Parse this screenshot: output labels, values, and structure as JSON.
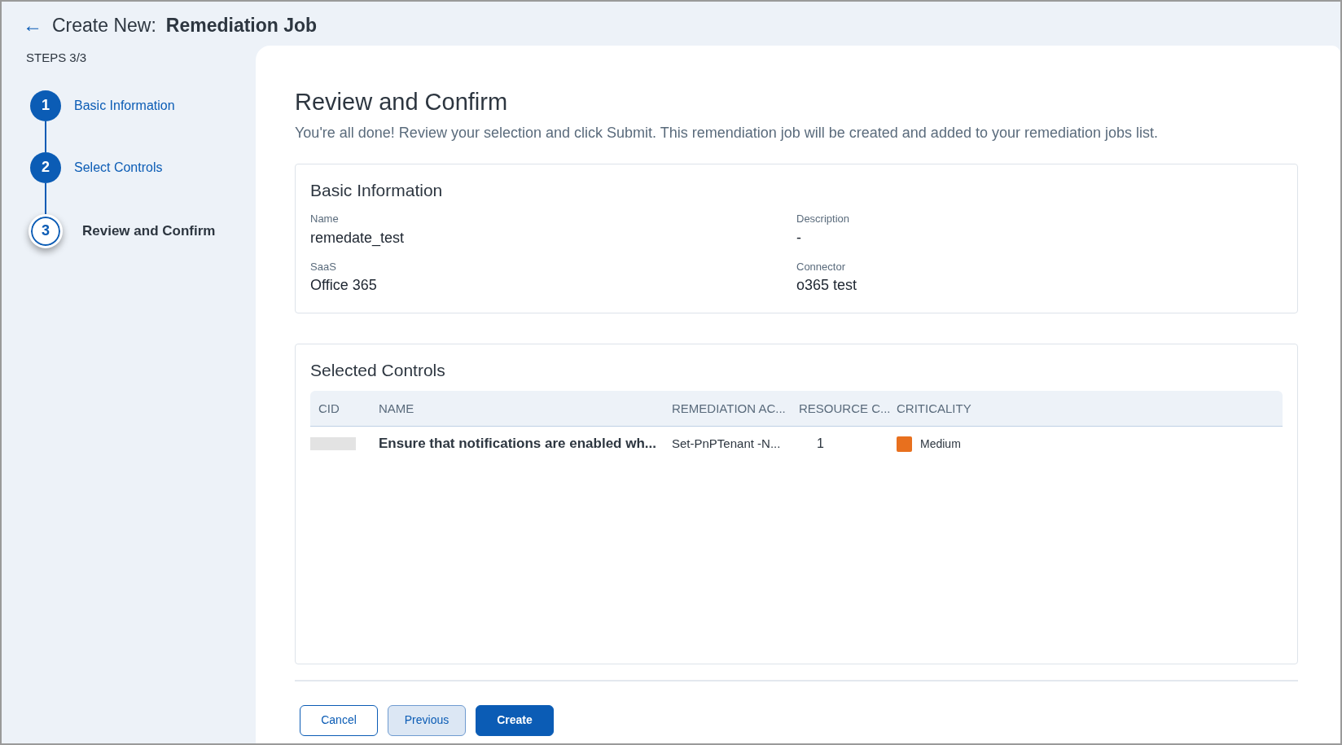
{
  "header": {
    "back_icon": "←",
    "title_prefix": "Create New:",
    "title": "Remediation Job"
  },
  "steps_label": "STEPS 3/3",
  "steps": [
    {
      "number": "1",
      "label": "Basic Information",
      "selected": false
    },
    {
      "number": "2",
      "label": "Select Controls",
      "selected": false
    },
    {
      "number": "3",
      "label": "Review and Confirm",
      "selected": true
    }
  ],
  "page_title": "Review and Confirm",
  "page_subtitle": "You're all done! Review your selection and click Submit. This remendiation job will be created and added to your remediation jobs list.",
  "basic_info": {
    "title": "Basic Information",
    "fields": [
      {
        "label": "Name",
        "value": "remedate_test"
      },
      {
        "label": "Description",
        "value": "-"
      },
      {
        "label": "SaaS",
        "value": "Office 365"
      },
      {
        "label": "Connector",
        "value": "o365 test"
      }
    ]
  },
  "selected_controls": {
    "title": "Selected Controls",
    "columns": [
      "CID",
      "NAME",
      "REMEDIATION AC...",
      "RESOURCE C...",
      "CRITICALITY"
    ],
    "rows": [
      {
        "name": "Ensure that notifications are enabled wh...",
        "remediation": "Set-PnPTenant -N...",
        "resources": "1",
        "criticality": "Medium",
        "color": "#e8701e"
      }
    ]
  },
  "buttons": [
    {
      "label": "Cancel",
      "kind": "outline"
    },
    {
      "label": "Previous",
      "kind": "soft"
    },
    {
      "label": "Create",
      "kind": "primary"
    }
  ]
}
